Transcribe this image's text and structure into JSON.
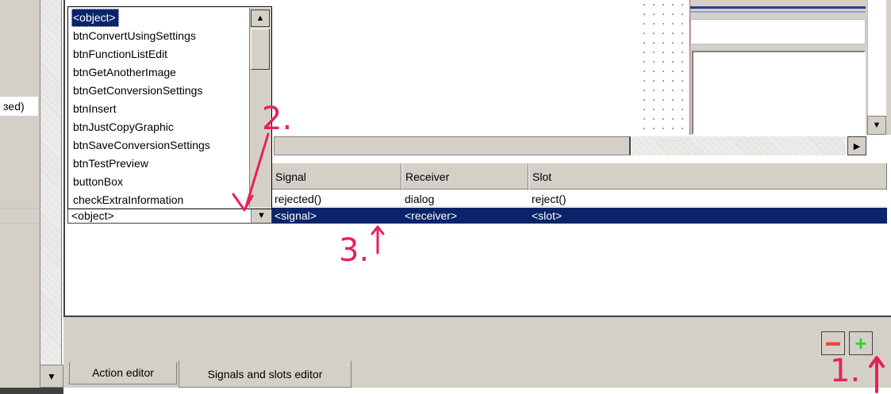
{
  "left_panel": {
    "partial_text": "ɜed)"
  },
  "dropdown": {
    "items": [
      "<object>",
      "btnConvertUsingSettings",
      "btnFunctionListEdit",
      "btnGetAnotherImage",
      "btnGetConversionSettings",
      "btnInsert",
      "btnJustCopyGraphic",
      "btnSaveConversionSettings",
      "btnTestPreview",
      "buttonBox",
      "checkExtraInformation"
    ],
    "selected_index": 0
  },
  "combo": {
    "value": "<object>"
  },
  "table": {
    "headers": [
      "Signal",
      "Receiver",
      "Slot"
    ],
    "rows": [
      {
        "signal": "rejected()",
        "receiver": "dialog",
        "slot": "reject()"
      },
      {
        "signal": "<signal>",
        "receiver": "<receiver>",
        "slot": "<slot>"
      }
    ]
  },
  "tabs": {
    "action_editor": "Action editor",
    "signals_slots_editor": "Signals and slots editor"
  },
  "buttons": {
    "remove": "−",
    "add": "+"
  },
  "annotations": {
    "step1": "1.",
    "step2": "2.",
    "step3": "3."
  },
  "colors": {
    "selection": "#0a246a",
    "annotation": "#e8205a",
    "add_green": "#2fd62f",
    "remove_red": "#e84848",
    "panel_gray": "#d4d0c8"
  }
}
